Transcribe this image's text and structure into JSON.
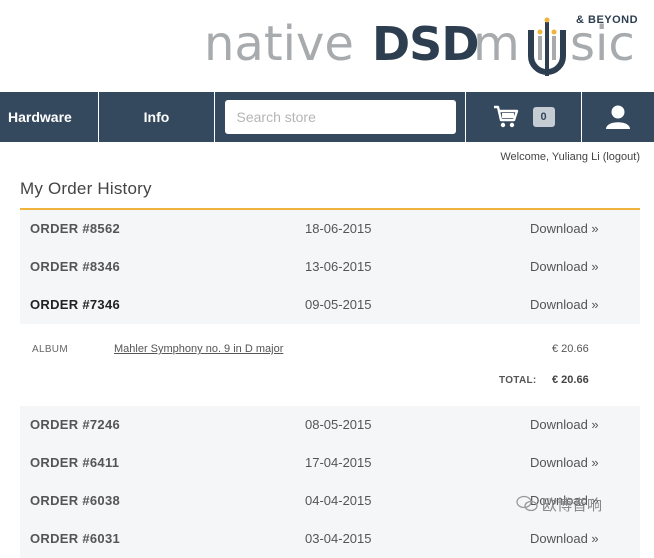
{
  "logo": {
    "word1": "native",
    "word2": "DSD",
    "word3a": "m",
    "word3b": "sic",
    "tagline": "& BEYOND"
  },
  "nav": {
    "hardware": "Hardware",
    "info": "Info",
    "search_placeholder": "Search store",
    "cart_count": "0"
  },
  "welcome": "Welcome, Yuliang Li (logout)",
  "page_title": "My Order History",
  "orders": [
    {
      "id": "ORDER #8562",
      "date": "18-06-2015",
      "action": "Download »"
    },
    {
      "id": "ORDER #8346",
      "date": "13-06-2015",
      "action": "Download »"
    },
    {
      "id": "ORDER #7346",
      "date": "09-05-2015",
      "action": "Download »"
    },
    {
      "id": "ORDER #7246",
      "date": "08-05-2015",
      "action": "Download »"
    },
    {
      "id": "ORDER #6411",
      "date": "17-04-2015",
      "action": "Download »"
    },
    {
      "id": "ORDER #6038",
      "date": "04-04-2015",
      "action": "Download »"
    },
    {
      "id": "ORDER #6031",
      "date": "03-04-2015",
      "action": "Download »"
    }
  ],
  "expanded_order": {
    "type": "ALBUM",
    "title": "Mahler Symphony no. 9 in D major",
    "price": "€ 20.66",
    "total_label": "TOTAL:",
    "total": "€ 20.66"
  },
  "watermark": "欧博音响",
  "colors": {
    "nav_bg": "#34495e",
    "accent_rule": "#f0b43c",
    "row_bg": "#f5f6f8",
    "logo_dark": "#2d3e50",
    "logo_grey": "#a8abae",
    "logo_gold": "#f0b43c"
  }
}
